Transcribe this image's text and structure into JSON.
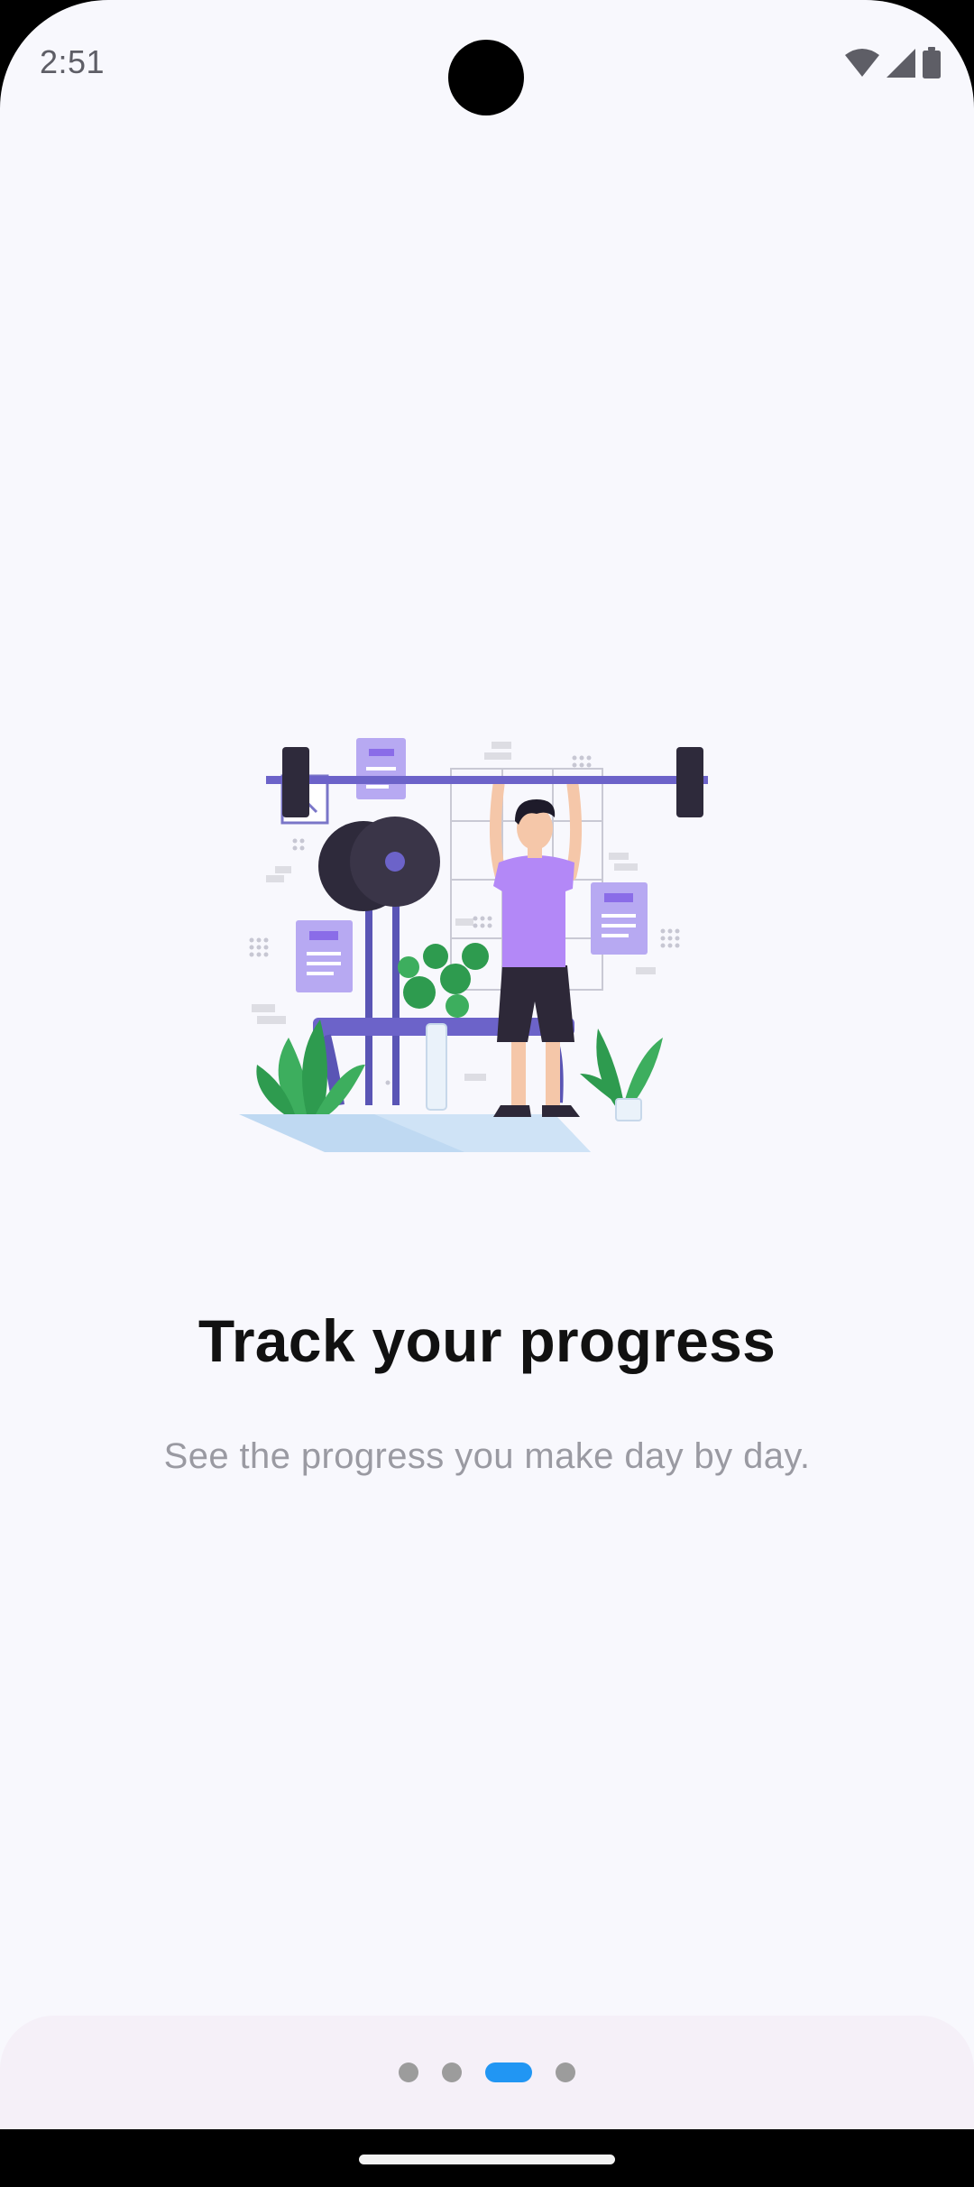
{
  "status_bar": {
    "time": "2:51",
    "icons": [
      "wifi-icon",
      "cellular-signal-icon",
      "battery-icon"
    ]
  },
  "onboarding": {
    "illustration": "person-lifting-barbell-illustration",
    "title": "Track your progress",
    "subtitle": "See the progress you make day by day."
  },
  "pager": {
    "page_count": 4,
    "active_page": 3
  },
  "colors": {
    "background": "#F8F8FD",
    "accent": "#2196F3",
    "inactive_dot": "#9C9C9C",
    "illustration_purple": "#6C63C9",
    "shirt": "#B388F7"
  }
}
